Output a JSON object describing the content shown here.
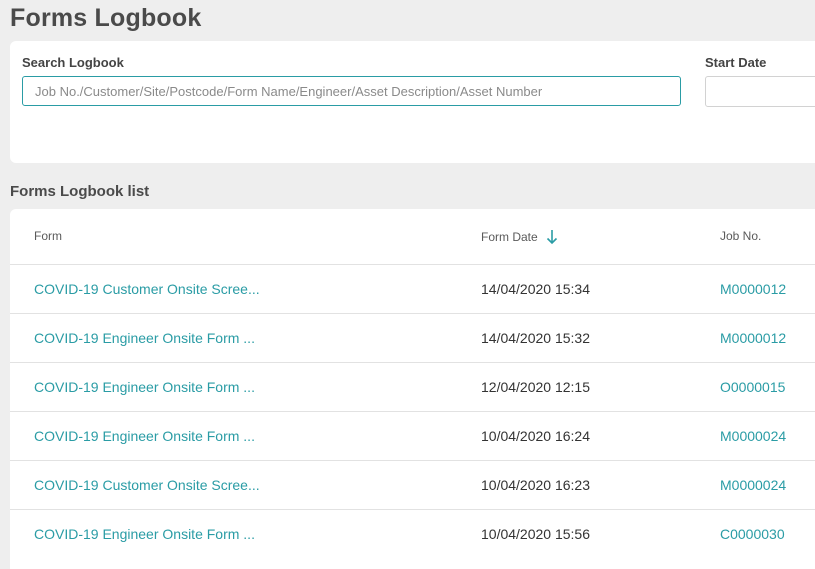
{
  "header": {
    "title": "Forms Logbook"
  },
  "search": {
    "label": "Search Logbook",
    "placeholder": "Job No./Customer/Site/Postcode/Form Name/Engineer/Asset Description/Asset Number",
    "value": "",
    "start_date_label": "Start Date",
    "start_date_value": ""
  },
  "list": {
    "title": "Forms Logbook list",
    "columns": {
      "form": "Form",
      "form_date": "Form Date",
      "job_no": "Job No."
    },
    "sort": {
      "column": "Form Date",
      "direction": "descending",
      "icon": "arrow-down-icon"
    },
    "rows": [
      {
        "form": "COVID-19 Customer Onsite Scree...",
        "date": "14/04/2020 15:34",
        "job": "M0000012"
      },
      {
        "form": "COVID-19 Engineer Onsite Form ...",
        "date": "14/04/2020 15:32",
        "job": "M0000012"
      },
      {
        "form": "COVID-19 Engineer Onsite Form ...",
        "date": "12/04/2020 12:15",
        "job": "O0000015"
      },
      {
        "form": "COVID-19 Engineer Onsite Form ...",
        "date": "10/04/2020 16:24",
        "job": "M0000024"
      },
      {
        "form": "COVID-19 Customer Onsite Scree...",
        "date": "10/04/2020 16:23",
        "job": "M0000024"
      },
      {
        "form": "COVID-19 Engineer Onsite Form ...",
        "date": "10/04/2020 15:56",
        "job": "C0000030"
      }
    ]
  },
  "colors": {
    "accent": "#2a9ca5",
    "background": "#eeeeee",
    "card": "#ffffff",
    "text": "#333333"
  }
}
